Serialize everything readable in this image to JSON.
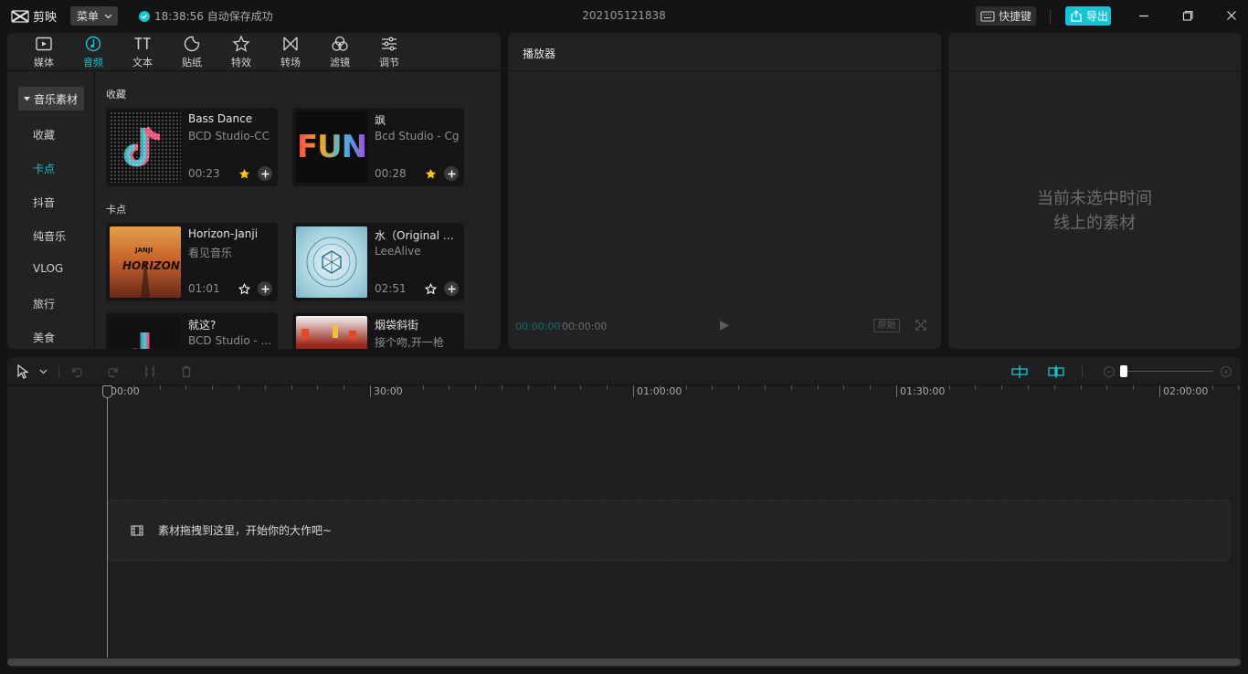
{
  "app": {
    "name": "剪映",
    "menu_label": "菜单",
    "autosave_text": "18:38:56 自动保存成功",
    "project_title": "202105121838",
    "shortcut_label": "快捷键",
    "export_label": "导出"
  },
  "tabs": [
    {
      "label": "媒体",
      "icon": "media-icon"
    },
    {
      "label": "音频",
      "icon": "audio-icon"
    },
    {
      "label": "文本",
      "icon": "text-icon"
    },
    {
      "label": "贴纸",
      "icon": "sticker-icon"
    },
    {
      "label": "特效",
      "icon": "effects-icon"
    },
    {
      "label": "转场",
      "icon": "transition-icon"
    },
    {
      "label": "滤镜",
      "icon": "filter-icon"
    },
    {
      "label": "调节",
      "icon": "adjust-icon"
    }
  ],
  "active_tab": "音频",
  "side_nav": {
    "header": "音乐素材",
    "items": [
      "收藏",
      "卡点",
      "抖音",
      "纯音乐",
      "VLOG",
      "旅行",
      "美食"
    ],
    "active": "卡点"
  },
  "sections": [
    {
      "label": "收藏",
      "cards": [
        {
          "title": "Bass Dance",
          "subtitle": "BCD Studio-CC",
          "duration": "00:23",
          "favorited": true
        },
        {
          "title": "飒",
          "subtitle": "Bcd Studio - Cg",
          "duration": "00:28",
          "favorited": true,
          "thumb_text": "FUN"
        }
      ]
    },
    {
      "label": "卡点",
      "cards": [
        {
          "title": "Horizon-Janji",
          "subtitle": "看见音乐",
          "duration": "01:01",
          "favorited": false,
          "thumb_text": "HORIZON",
          "thumb_small": "JANJI"
        },
        {
          "title": "水（Original M...",
          "subtitle": "LeeAlive",
          "duration": "02:51",
          "favorited": false
        },
        {
          "title": "就这?",
          "subtitle": "BCD Studio - ...",
          "duration": "",
          "favorited": false
        },
        {
          "title": "烟袋斜街",
          "subtitle": "接个吻,开一枪",
          "duration": "",
          "favorited": false
        }
      ]
    }
  ],
  "player": {
    "title": "播放器",
    "current_time": "00:00:00",
    "total_time": "00:00:00",
    "original_label": "原始"
  },
  "properties": {
    "empty_line1": "当前未选中时间",
    "empty_line2": "线上的素材"
  },
  "timeline": {
    "ruler_labels": [
      "00:00",
      "30:00",
      "01:00:00",
      "01:30:00",
      "02:00:00"
    ],
    "drop_hint": "素材拖拽到这里，开始你的大作吧~",
    "zoom_level": 0.0
  },
  "colors": {
    "accent": "#19c3d0",
    "star": "#f5c518",
    "export_bg": "#14c6d2"
  }
}
